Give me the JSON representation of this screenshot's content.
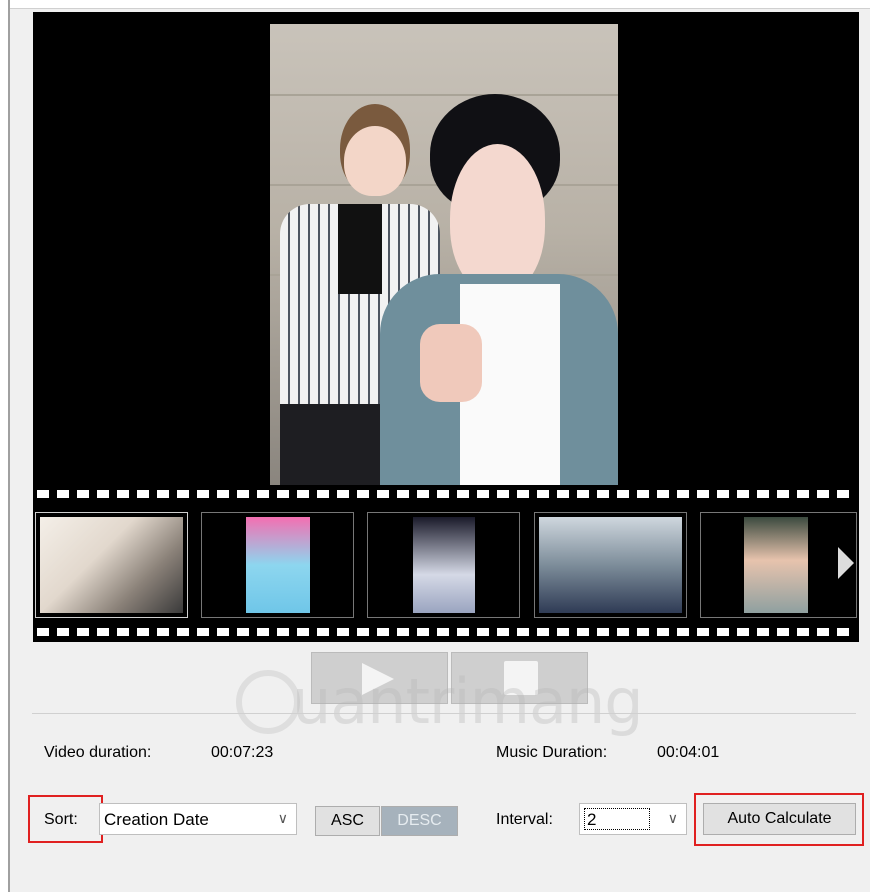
{
  "preview": {
    "description_icon": "photo-preview"
  },
  "filmstrip": {
    "thumb_count": 5,
    "next_icon": "triangle-right-icon"
  },
  "transport": {
    "play_icon": "play-icon",
    "stop_icon": "stop-icon"
  },
  "watermark": {
    "text": "uantrimang"
  },
  "info": {
    "video_duration_label": "Video duration:",
    "video_duration_value": "00:07:23",
    "music_duration_label": "Music Duration:",
    "music_duration_value": "00:04:01"
  },
  "controls": {
    "sort_label": "Sort:",
    "sort_value": "Creation Date",
    "asc_label": "ASC",
    "desc_label": "DESC",
    "interval_label": "Interval:",
    "interval_value": "2",
    "auto_calculate_label": "Auto Calculate"
  },
  "colors": {
    "highlight": "#e02020",
    "preview_bg": "#000000"
  }
}
